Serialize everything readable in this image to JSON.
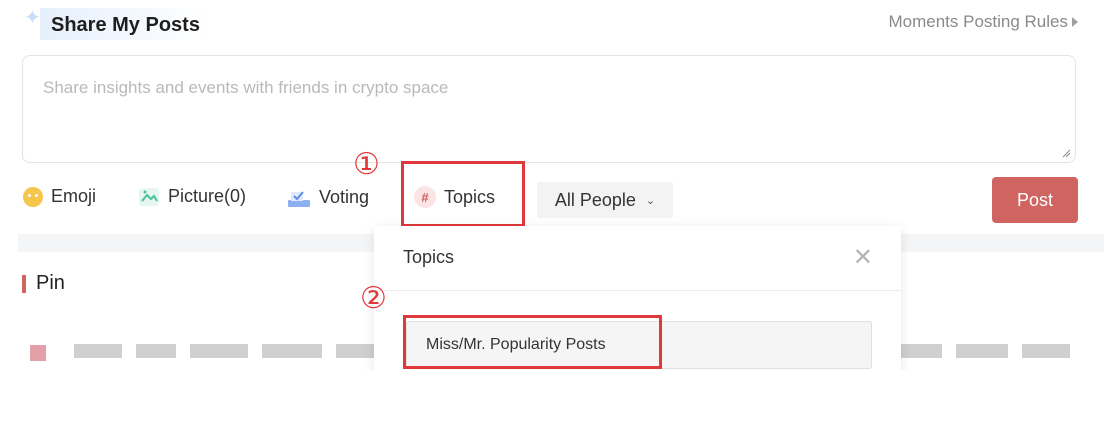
{
  "header": {
    "title": "Share My Posts",
    "rules_link": "Moments Posting Rules"
  },
  "composer": {
    "placeholder": "Share insights and events with friends in crypto space"
  },
  "toolbar": {
    "emoji_label": "Emoji",
    "picture_label": "Picture(0)",
    "voting_label": "Voting",
    "topics_label": "Topics",
    "audience_label": "All People",
    "post_label": "Post"
  },
  "section": {
    "pin_label": "Pin"
  },
  "popup": {
    "title": "Topics",
    "items": [
      {
        "label": "Miss/Mr. Popularity Posts"
      }
    ]
  },
  "annotations": {
    "step1": "①",
    "step2": "②"
  },
  "icons": {
    "sparkle": "sparkle-icon",
    "emoji": "emoji-icon",
    "picture": "picture-icon",
    "voting": "voting-icon",
    "topics": "hashtag-icon",
    "chevron": "chevron-down-icon",
    "close": "close-icon"
  },
  "colors": {
    "accent": "#d06460",
    "annotation": "#e0383b",
    "emoji": "#f6c64c",
    "picture": "#4cc29a",
    "voting": "#5b8fe8"
  }
}
